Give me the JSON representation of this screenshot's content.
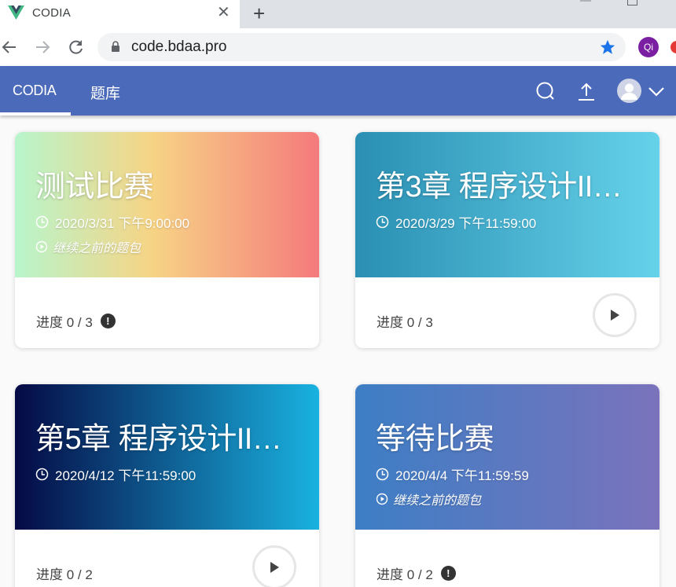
{
  "browser": {
    "tab_title": "CODIA",
    "url": "code.bdaa.pro",
    "ext_label": "Qi"
  },
  "app": {
    "brand": "CODIA",
    "nav_tab": "题库"
  },
  "cards": [
    {
      "title": "测试比赛",
      "date": "2020/3/31 下午9:00:00",
      "continue": "继续之前的题包",
      "progress": "进度 0 / 3",
      "gradient": [
        "#b8f5cc",
        "#f6d485",
        "#f57a7c"
      ]
    },
    {
      "title": "第3章 程序设计II…",
      "date": "2020/3/29 下午11:59:00",
      "progress": "进度 0 / 3",
      "gradient": [
        "#2a8fb3",
        "#66d2ea"
      ]
    },
    {
      "title": "第5章 程序设计II…",
      "date": "2020/4/12 下午11:59:00",
      "progress": "进度 0 / 2",
      "gradient": [
        "#050a45",
        "#19b2e0"
      ]
    },
    {
      "title": "等待比赛",
      "date": "2020/4/4 下午11:59:59",
      "continue": "继续之前的题包",
      "progress": "进度 0 / 2",
      "gradient": [
        "#3d7ec5",
        "#7a73bc"
      ]
    }
  ],
  "colors": {
    "appbar": "#4b6bba",
    "star": "#1a73e8"
  },
  "icons": [
    "vue-logo-icon",
    "close-icon",
    "plus-icon",
    "back-arrow-icon",
    "forward-arrow-icon",
    "reload-icon",
    "lock-icon",
    "star-icon",
    "search-icon",
    "upload-icon",
    "avatar-icon",
    "chevron-down-icon",
    "clock-icon",
    "play-circle-icon",
    "exclamation-icon",
    "play-icon"
  ]
}
